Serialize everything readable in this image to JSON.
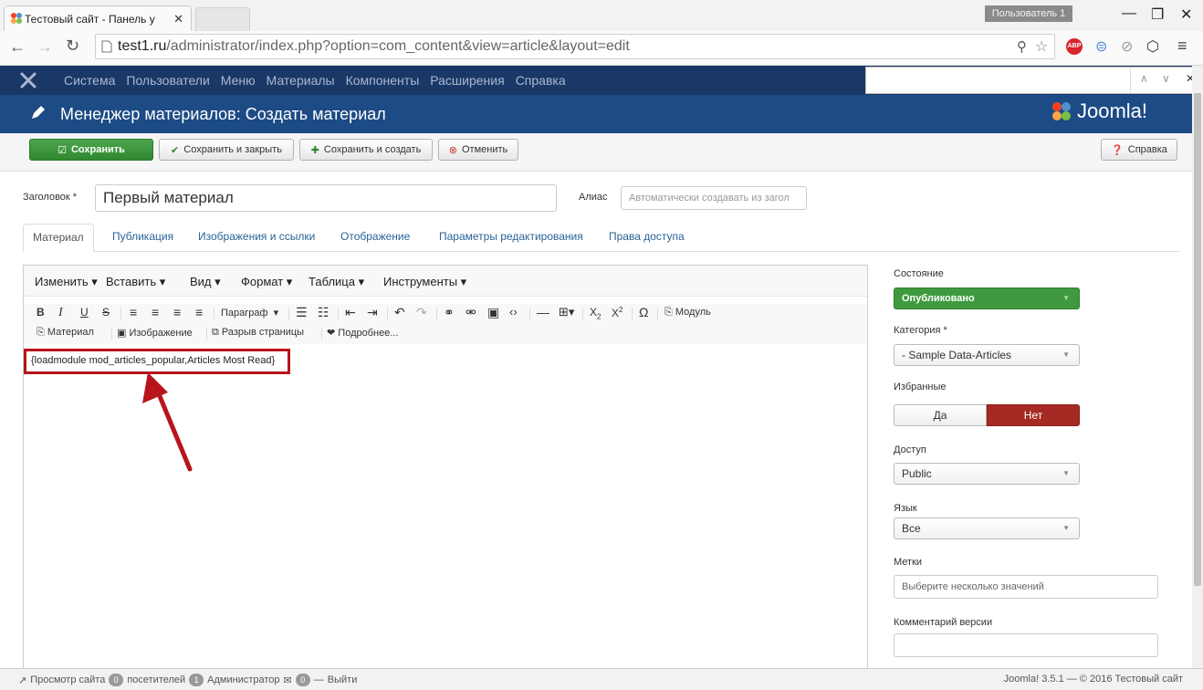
{
  "browser": {
    "tab_title": "Тестовый сайт - Панель у",
    "user_badge": "Пользователь 1",
    "url_host": "test1.ru",
    "url_path": "/administrator/index.php?option=com_content&view=article&layout=edit"
  },
  "menu": {
    "items": [
      "Система",
      "Пользователи",
      "Меню",
      "Материалы",
      "Компоненты",
      "Расширения",
      "Справка"
    ]
  },
  "header": {
    "title": "Менеджер материалов: Создать материал",
    "logo_text": "Joomla!"
  },
  "toolbar": {
    "save": "Сохранить",
    "save_close": "Сохранить и закрыть",
    "save_new": "Сохранить и создать",
    "cancel": "Отменить",
    "help": "Справка"
  },
  "form": {
    "title_label": "Заголовок *",
    "title_value": "Первый материал",
    "alias_label": "Алиас",
    "alias_placeholder": "Автоматически создавать из загол"
  },
  "tabs": [
    "Материал",
    "Публикация",
    "Изображения и ссылки",
    "Отображение",
    "Параметры редактирования",
    "Права доступа"
  ],
  "editor": {
    "menu": [
      "Изменить ▾",
      "Вставить ▾",
      "Вид ▾",
      "Формат ▾",
      "Таблица ▾",
      "Инструменты ▾"
    ],
    "paragraph": "Параграф",
    "module": "Модуль",
    "buttons": {
      "article": "Материал",
      "image": "Изображение",
      "pagebreak": "Разрыв страницы",
      "readmore": "Подробнее..."
    },
    "content": "{loadmodule mod_articles_popular,Articles Most Read}"
  },
  "sidebar": {
    "state_label": "Состояние",
    "state_value": "Опубликовано",
    "category_label": "Категория *",
    "category_value": "- Sample Data-Articles",
    "featured_label": "Избранные",
    "featured_yes": "Да",
    "featured_no": "Нет",
    "access_label": "Доступ",
    "access_value": "Public",
    "language_label": "Язык",
    "language_value": "Все",
    "tags_label": "Метки",
    "tags_placeholder": "Выберите несколько значений",
    "version_label": "Комментарий версии"
  },
  "statusbar": {
    "view_site": "Просмотр сайта",
    "visitors_count": "0",
    "visitors": "посетителей",
    "admins_count": "1",
    "admins": "Администратор",
    "messages_count": "0",
    "logout": "Выйти",
    "version": "Joomla! 3.5.1 — © 2016 Тестовый сайт"
  },
  "colors": {
    "menu_bg": "#1a3867",
    "header_bg": "#1d4b85",
    "save_green": "#3f9a3f",
    "no_red": "#a52a23",
    "highlight": "#b8141b"
  }
}
